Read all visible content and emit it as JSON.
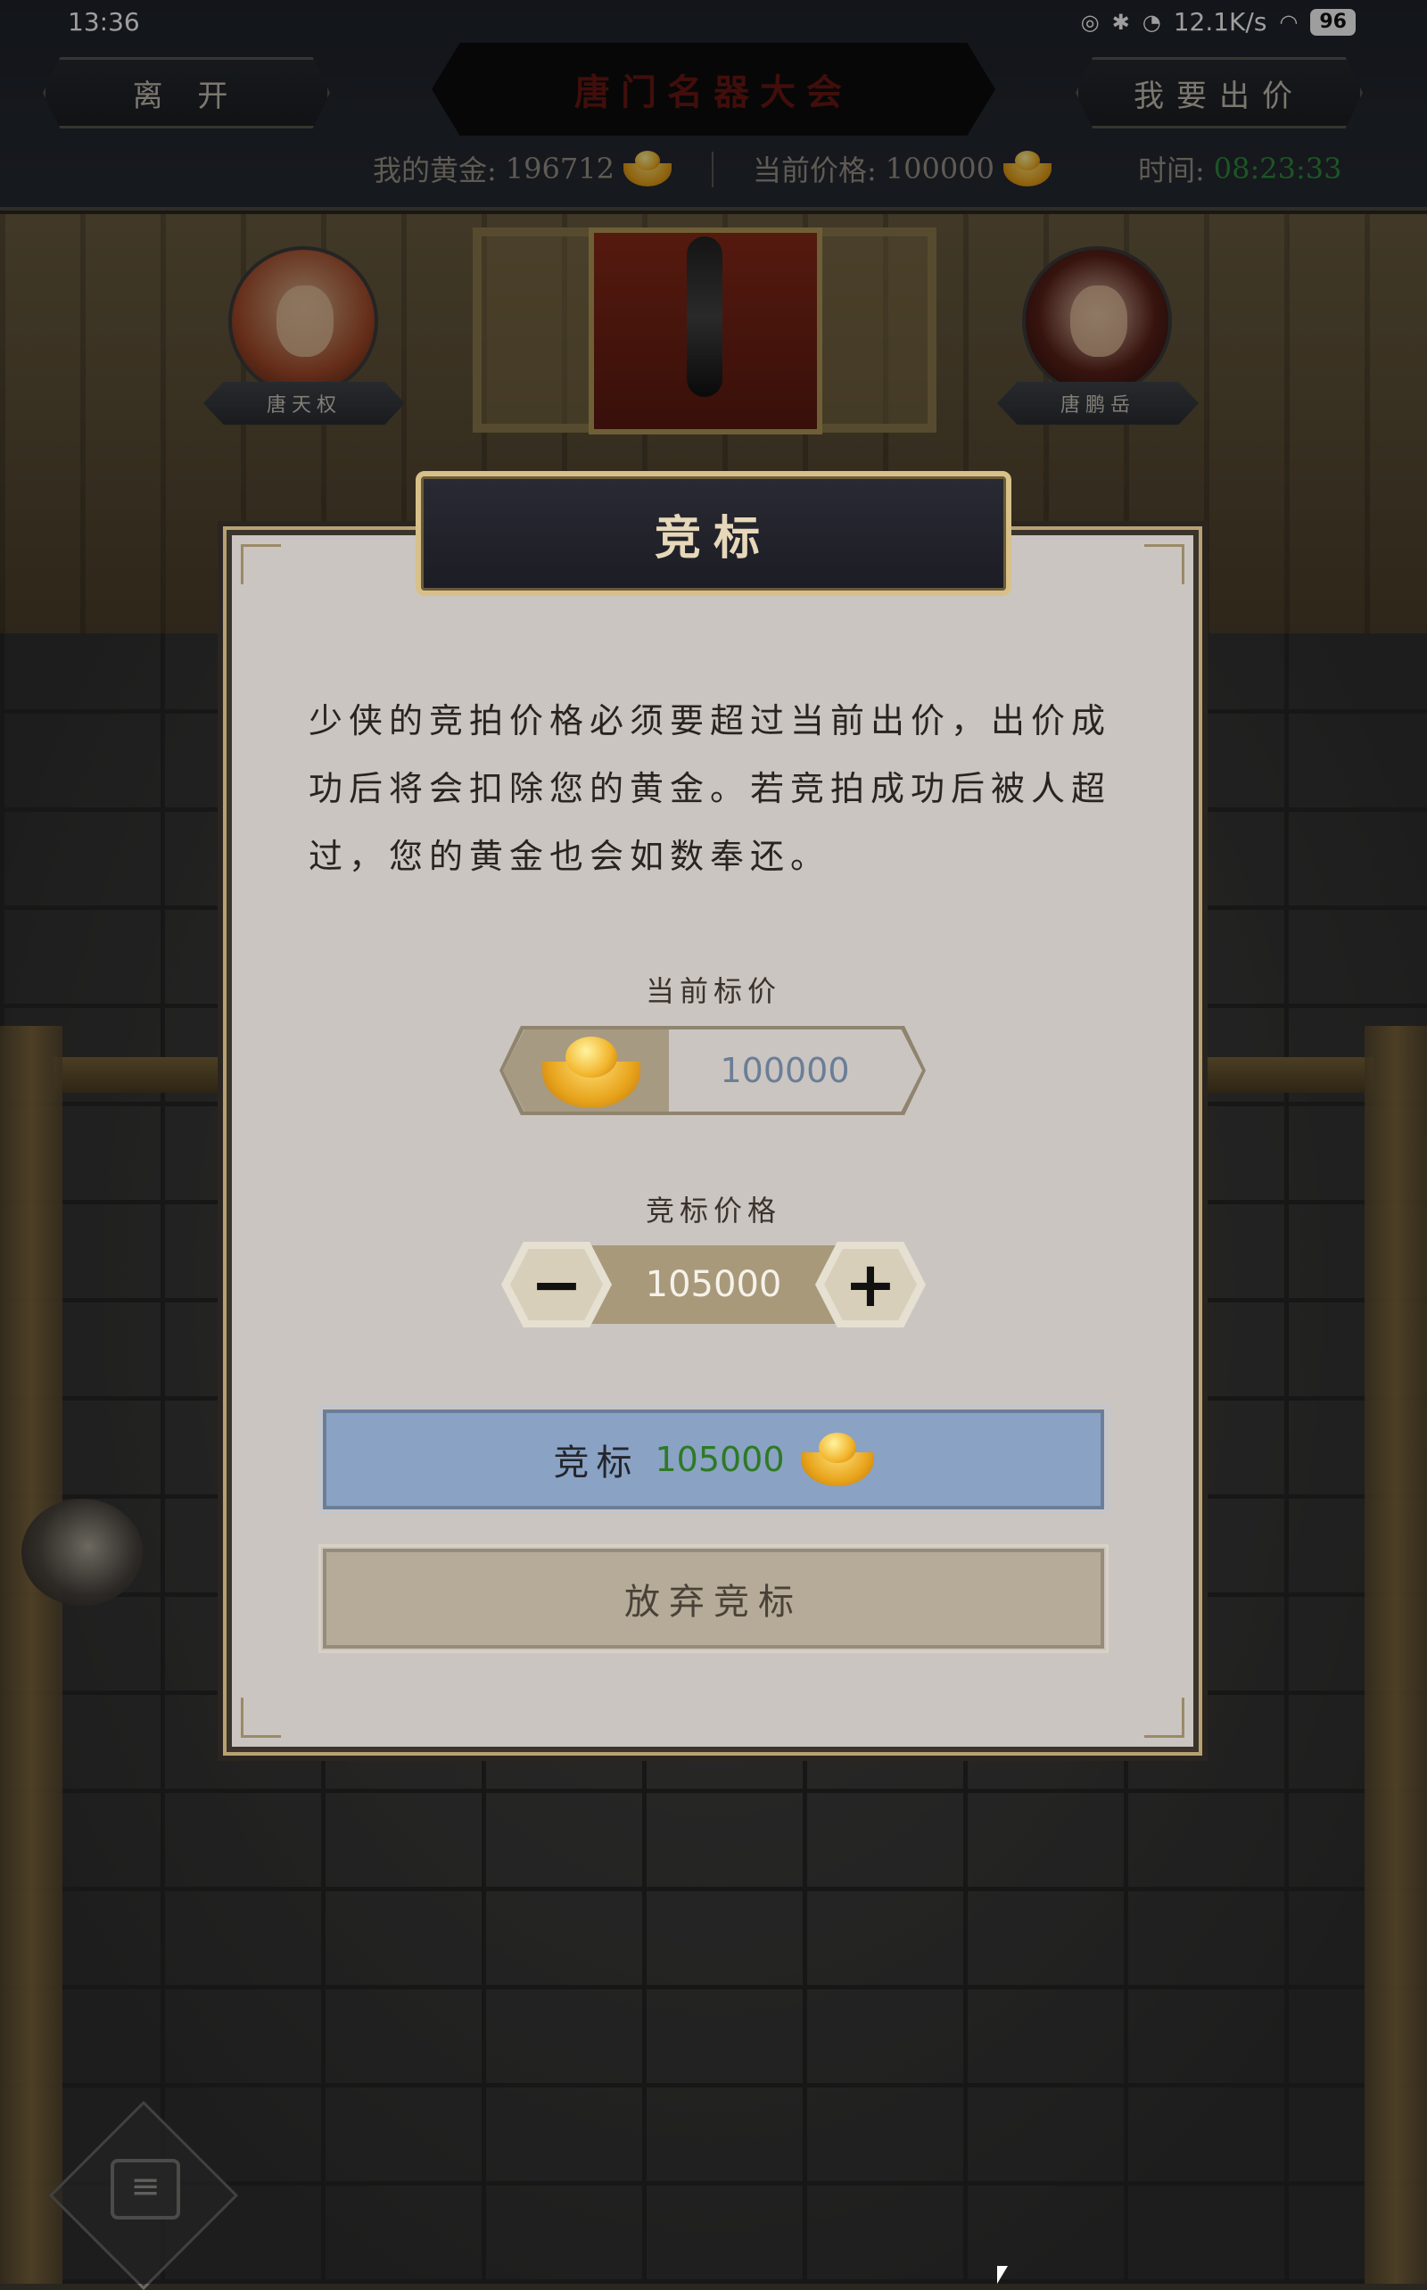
{
  "status_bar": {
    "time": "13:36",
    "network_speed": "12.1K/s",
    "battery": "96"
  },
  "header": {
    "leave_label": "离 开",
    "title": "唐门名器大会",
    "bid_label": "我要出价",
    "gold_label": "我的黄金:",
    "gold_value": "196712",
    "price_label": "当前价格:",
    "price_value": "100000",
    "time_label": "时间:",
    "time_value": "08:23:33"
  },
  "players": {
    "left_name": "唐天权",
    "right_name": "唐鹏岳"
  },
  "modal": {
    "title": "竞标",
    "description": "少侠的竞拍价格必须要超过当前出价，出价成功后将会扣除您的黄金。若竞拍成功后被人超过，您的黄金也会如数奉还。",
    "current_price_label": "当前标价",
    "current_price_value": "100000",
    "bid_price_label": "竞标价格",
    "bid_price_value": "105000",
    "minus_label": "−",
    "plus_label": "+",
    "confirm_label": "竞标",
    "confirm_amount": "105000",
    "abandon_label": "放弃竞标"
  },
  "colors": {
    "accent_gold": "#d8c08a",
    "confirm_bg": "#8aa2c4",
    "amount_green": "#2e7a24",
    "time_green": "#2e8a3a"
  },
  "icons": [
    "gold-ingot-icon",
    "chat-icon",
    "minus-icon",
    "plus-icon"
  ]
}
